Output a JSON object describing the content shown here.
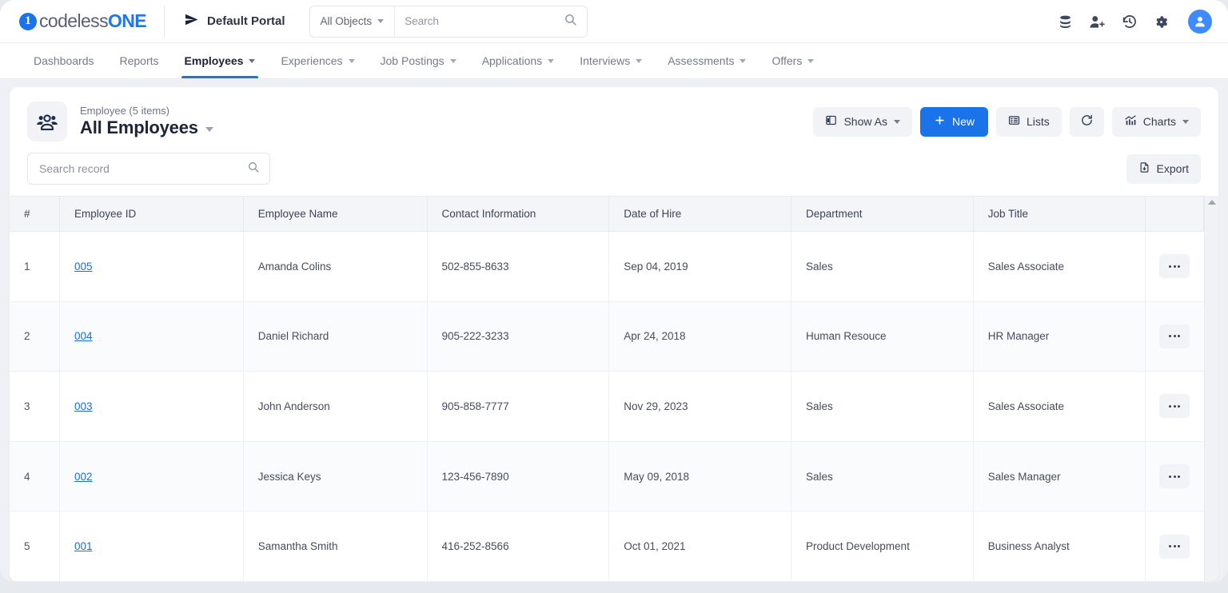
{
  "brand": {
    "name_part1": "codeless",
    "name_part2": "ONE",
    "mark": "1"
  },
  "topbar": {
    "portal_label": "Default Portal",
    "portal_icon": "send-icon",
    "object_filter": "All Objects",
    "search_placeholder": "Search",
    "search_value": "",
    "icons": [
      {
        "name": "database-icon",
        "label": "Database"
      },
      {
        "name": "add-user-icon",
        "label": "Add User"
      },
      {
        "name": "history-icon",
        "label": "History"
      },
      {
        "name": "gear-icon",
        "label": "Settings"
      },
      {
        "name": "avatar-icon",
        "label": "Profile"
      }
    ]
  },
  "nav": {
    "items": [
      {
        "label": "Dashboards",
        "has_caret": false,
        "active": false
      },
      {
        "label": "Reports",
        "has_caret": false,
        "active": false
      },
      {
        "label": "Employees",
        "has_caret": true,
        "active": true
      },
      {
        "label": "Experiences",
        "has_caret": true,
        "active": false
      },
      {
        "label": "Job Postings",
        "has_caret": true,
        "active": false
      },
      {
        "label": "Applications",
        "has_caret": true,
        "active": false
      },
      {
        "label": "Interviews",
        "has_caret": true,
        "active": false
      },
      {
        "label": "Assessments",
        "has_caret": true,
        "active": false
      },
      {
        "label": "Offers",
        "has_caret": true,
        "active": false
      }
    ]
  },
  "header": {
    "icon": "people-group-icon",
    "subtitle": "Employee (5 items)",
    "title": "All Employees",
    "buttons": {
      "show_as": "Show As",
      "new": "New",
      "lists": "Lists",
      "refresh": "",
      "charts": "Charts"
    }
  },
  "toolbar": {
    "search_placeholder": "Search record",
    "search_value": "",
    "export_label": "Export"
  },
  "table": {
    "columns": [
      "#",
      "Employee ID",
      "Employee Name",
      "Contact Information",
      "Date of Hire",
      "Department",
      "Job Title",
      ""
    ],
    "rows": [
      {
        "index": "1",
        "employee_id": "005",
        "name": "Amanda Colins",
        "contact": "502-855-8633",
        "hire_date": "Sep 04, 2019",
        "department": "Sales",
        "job_title": "Sales Associate"
      },
      {
        "index": "2",
        "employee_id": "004",
        "name": "Daniel Richard",
        "contact": "905-222-3233",
        "hire_date": "Apr 24, 2018",
        "department": "Human Resouce",
        "job_title": "HR Manager"
      },
      {
        "index": "3",
        "employee_id": "003",
        "name": "John Anderson",
        "contact": "905-858-7777",
        "hire_date": "Nov 29, 2023",
        "department": "Sales",
        "job_title": "Sales Associate"
      },
      {
        "index": "4",
        "employee_id": "002",
        "name": "Jessica Keys",
        "contact": "123-456-7890",
        "hire_date": "May 09, 2018",
        "department": "Sales",
        "job_title": "Sales Manager"
      },
      {
        "index": "5",
        "employee_id": "001",
        "name": "Samantha Smith",
        "contact": "416-252-8566",
        "hire_date": "Oct 01, 2021",
        "department": "Product Development",
        "job_title": "Business Analyst"
      }
    ],
    "row_action_icon": "more-options-icon"
  },
  "colors": {
    "accent": "#1a73e8",
    "link": "#1a6fe0",
    "page_bg": "#eef0f3",
    "header_bg": "#f3f5f8",
    "button_bg": "#f1f3f7"
  }
}
